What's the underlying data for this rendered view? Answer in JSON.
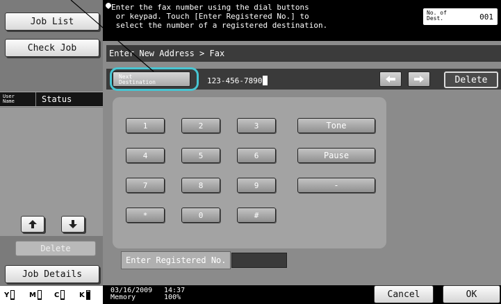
{
  "left_panel": {
    "job_list_label": "Job List",
    "check_job_label": "Check Job",
    "user_name_header": "User\nName",
    "status_header": "Status",
    "delete_label": "Delete",
    "job_details_label": "Job Details",
    "toner": [
      {
        "label": "Y",
        "level": 0.1
      },
      {
        "label": "M",
        "level": 0.1
      },
      {
        "label": "C",
        "level": 0.1
      },
      {
        "label": "K",
        "level": 0.95
      }
    ]
  },
  "message": {
    "text": "Enter the fax number using the dial buttons\n or keypad. Touch [Enter Registered No.] to\n select the number of a registered destination.",
    "dest_label": "No. of\nDest.",
    "dest_count": "001"
  },
  "main": {
    "breadcrumb": "Enter New Address > Fax",
    "next_destination_label": "Next\nDestination",
    "fax_number": "123-456-7890",
    "delete_label": "Delete",
    "keys": [
      "1",
      "2",
      "3",
      "4",
      "5",
      "6",
      "7",
      "8",
      "9",
      "*",
      "0",
      "#"
    ],
    "tone_label": "Tone",
    "pause_label": "Pause",
    "dash_label": "-",
    "enter_registered_label": "Enter Registered No."
  },
  "bottom": {
    "date": "03/16/2009\nMemory",
    "time": "14:37\n100%",
    "cancel_label": "Cancel",
    "ok_label": "OK"
  },
  "colors": {
    "highlight": "#47c6d3"
  }
}
